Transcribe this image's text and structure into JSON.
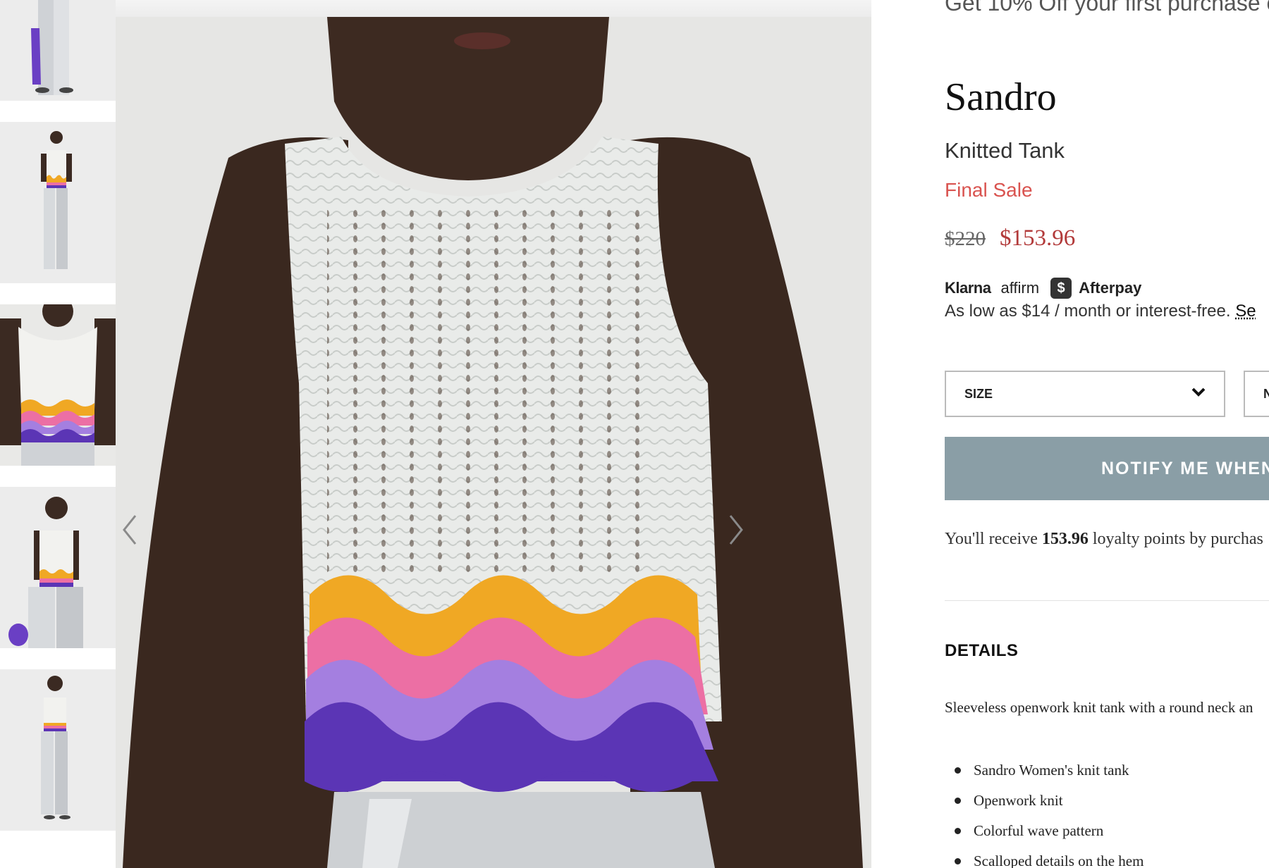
{
  "promo": {
    "text": "Get 10% Off your first purchase o"
  },
  "product": {
    "brand": "Sandro",
    "name": "Knitted Tank",
    "sale_label": "Final Sale",
    "original_price": "$220",
    "sale_price": "$153.96"
  },
  "payment": {
    "klarna": "Klarna",
    "affirm": "affirm",
    "afterpay": "Afterpay",
    "installments_text": "As low as $14 / month or interest-free. ",
    "installments_link": "Se"
  },
  "options": {
    "size_label": "SIZE",
    "qty_label": "N"
  },
  "notify_button": "NOTIFY ME WHEN",
  "loyalty": {
    "prefix": "You'll receive ",
    "points": "153.96",
    "suffix": " loyalty points by purchas"
  },
  "details": {
    "heading": "DETAILS",
    "description": "Sleeveless openwork knit tank with a round neck an",
    "bullets": [
      "Sandro Women's knit tank",
      "Openwork knit",
      "Colorful wave pattern",
      "Scalloped details on the hem"
    ]
  },
  "colors": {
    "sale_red": "#d9534f",
    "price_red": "#b23a3a",
    "notify_bg": "#8a9ea6",
    "stripe_yellow": "#f0a824",
    "stripe_pink": "#ec6fa4",
    "stripe_lilac": "#a47fe0",
    "stripe_purple": "#5b35b5"
  },
  "icons": {
    "prev": "chevron-left-icon",
    "next": "chevron-right-icon",
    "dropdown": "chevron-down-icon"
  }
}
